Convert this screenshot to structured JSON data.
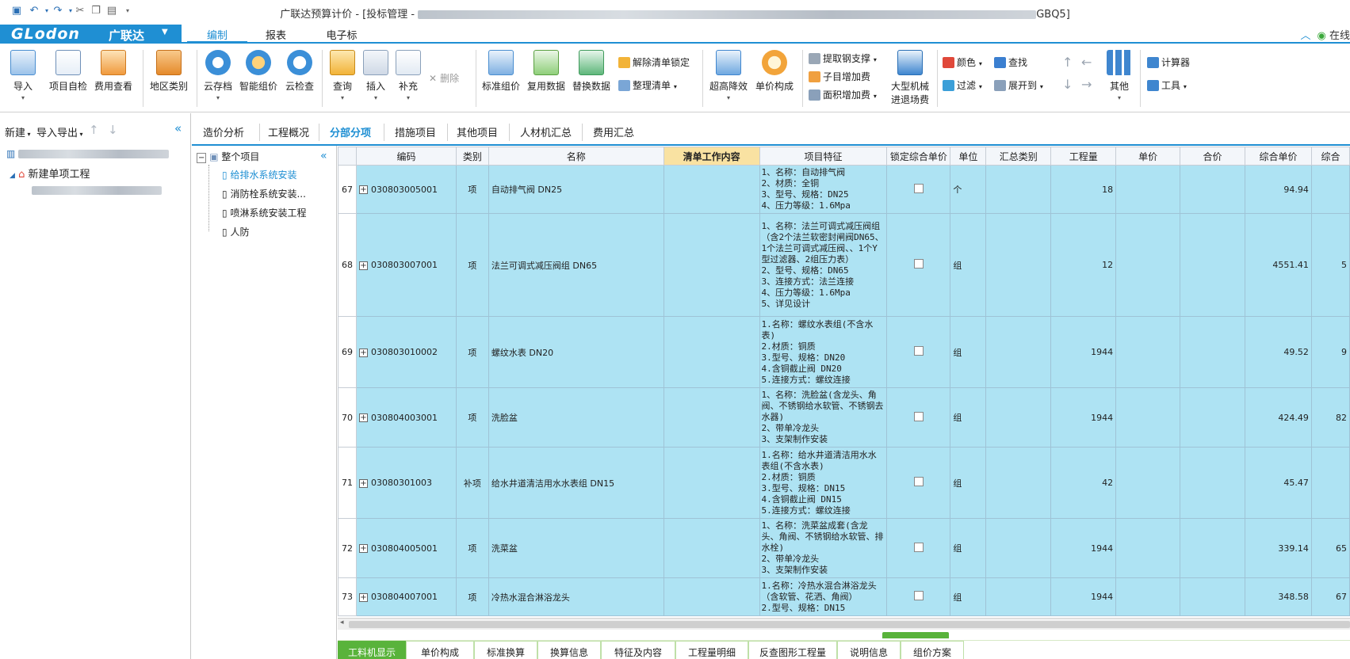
{
  "titlebar": {
    "title_prefix": "广联达预算计价 - [投标管理 - ",
    "title_suffix": "GBQ5]"
  },
  "menubar": {
    "brand_logo": "GLodon",
    "brand_cn": "广联达",
    "tabs": [
      "编制",
      "报表",
      "电子标"
    ],
    "active_tab": "编制",
    "right_text": "在线"
  },
  "ribbon": {
    "import": "导入",
    "self_check": "项目自检",
    "fee_view": "费用查看",
    "region": "地区类别",
    "cloud_save": "云存档",
    "smart_price": "智能组价",
    "cloud_check": "云检查",
    "query": "查询",
    "insert": "插入",
    "supplement": "补充",
    "delete": "删除",
    "std_price": "标准组价",
    "reuse": "复用数据",
    "replace": "替换数据",
    "unlock": "解除清单锁定",
    "organize": "整理清单",
    "high_reduce": "超高降效",
    "unit_comp": "单价构成",
    "steel": "提取钢支撑",
    "sub_add": "子目增加费",
    "area_add": "面积增加费",
    "machine_1": "大型机械",
    "machine_2": "进退场费",
    "color": "颜色",
    "find": "查找",
    "filter": "过滤",
    "expand": "展开到",
    "other": "其他",
    "calculator": "计算器",
    "tools": "工具"
  },
  "left_panel": {
    "new": "新建",
    "import_export": "导入导出",
    "tree_item": "新建单项工程"
  },
  "project_tabs": [
    "造价分析",
    "工程概况",
    "分部分项",
    "措施项目",
    "其他项目",
    "人材机汇总",
    "费用汇总"
  ],
  "active_project_tab": "分部分项",
  "mid_tree": {
    "root": "整个项目",
    "items": [
      "给排水系统安装",
      "消防栓系统安装...",
      "喷淋系统安装工程",
      "人防"
    ],
    "selected": "给排水系统安装"
  },
  "grid": {
    "headers": [
      "编码",
      "类别",
      "名称",
      "清单工作内容",
      "项目特征",
      "锁定综合单价",
      "单位",
      "汇总类别",
      "工程量",
      "单价",
      "合价",
      "综合单价",
      "综合"
    ],
    "rows": [
      {
        "n": "67",
        "code": "030803005001",
        "type": "项",
        "name": "自动排气阀 DN25",
        "feature": "1、名称：自动排气阀\n2、材质：全铜\n3、型号、规格：DN25\n4、压力等级：1.6Mpa",
        "unit": "个",
        "qty": "18",
        "comp_price": "94.94",
        "comp_total": ""
      },
      {
        "n": "68",
        "code": "030803007001",
        "type": "项",
        "name": "法兰可调式减压阀组 DN65",
        "feature": "1、名称：法兰可调式减压阀组（含2个法兰软密封闸阀DN65、1个法兰可调式减压阀、、1个Y型过滤器、2组压力表）\n2、型号、规格：DN65\n3、连接方式：法兰连接\n4、压力等级：1.6Mpa\n5、详见设计",
        "unit": "组",
        "qty": "12",
        "comp_price": "4551.41",
        "comp_total": "5"
      },
      {
        "n": "69",
        "code": "030803010002",
        "type": "项",
        "name": "螺纹水表 DN20",
        "feature": "1.名称：螺纹水表组(不含水表)\n2.材质：铜质\n3.型号、规格：DN20\n4.含铜截止阀 DN20\n5.连接方式：螺纹连接",
        "unit": "组",
        "qty": "1944",
        "comp_price": "49.52",
        "comp_total": "9"
      },
      {
        "n": "70",
        "code": "030804003001",
        "type": "项",
        "name": "洗脸盆",
        "feature": "1、名称：洗脸盆(含龙头、角阀、不锈钢给水软管、不锈钢去水器)\n2、带单冷龙头\n3、支架制作安装",
        "unit": "组",
        "qty": "1944",
        "comp_price": "424.49",
        "comp_total": "82"
      },
      {
        "n": "71",
        "code": "03080301003",
        "type": "补项",
        "name": "给水井道清洁用水水表组 DN15",
        "feature": "1.名称：给水井道清洁用水水表组(不含水表)\n2.材质：铜质\n3.型号、规格：DN15\n4.含铜截止阀 DN15\n5.连接方式：螺纹连接",
        "unit": "组",
        "qty": "42",
        "comp_price": "45.47",
        "comp_total": ""
      },
      {
        "n": "72",
        "code": "030804005001",
        "type": "项",
        "name": "洗菜盆",
        "feature": "1、名称：洗菜盆成套(含龙头、角阀、不锈钢给水软管、排水栓)\n2、带单冷龙头\n3、支架制作安装",
        "unit": "组",
        "qty": "1944",
        "comp_price": "339.14",
        "comp_total": "65"
      },
      {
        "n": "73",
        "code": "030804007001",
        "type": "项",
        "name": "冷热水混合淋浴龙头",
        "feature": "1.名称：冷热水混合淋浴龙头（含软管、花洒、角阀）\n2.型号、规格：DN15",
        "unit": "组",
        "qty": "1944",
        "comp_price": "348.58",
        "comp_total": "67"
      }
    ]
  },
  "bottom_tabs": [
    "工料机显示",
    "单价构成",
    "标准换算",
    "换算信息",
    "特征及内容",
    "工程量明细",
    "反查图形工程量",
    "说明信息",
    "组价方案"
  ],
  "active_bottom_tab": "工料机显示"
}
